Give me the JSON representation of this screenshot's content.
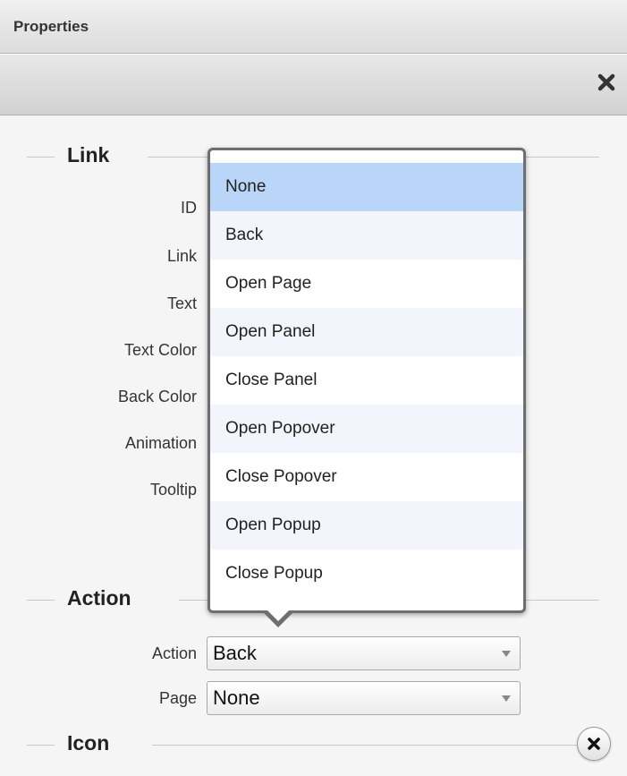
{
  "panel": {
    "title": "Properties",
    "close_icon": "close-icon"
  },
  "sections": {
    "link": {
      "title": "Link",
      "fields": [
        "ID",
        "Link",
        "Text",
        "Text Color",
        "Back Color",
        "Animation",
        "Tooltip"
      ]
    },
    "action": {
      "title": "Action",
      "action_label": "Action",
      "action_value": "Back",
      "page_label": "Page",
      "page_value": "None"
    },
    "icon": {
      "title": "Icon",
      "clear_icon": "close-icon"
    }
  },
  "dropdown": {
    "items": [
      "None",
      "Back",
      "Open Page",
      "Open Panel",
      "Close Panel",
      "Open Popover",
      "Close Popover",
      "Open Popup",
      "Close Popup"
    ],
    "selected": "None"
  }
}
